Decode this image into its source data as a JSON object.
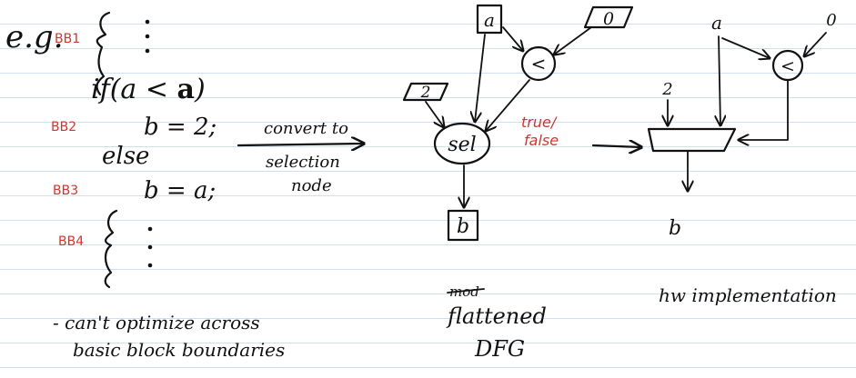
{
  "left_code": {
    "eg_label": "e.g.",
    "bb1_label": "BB1",
    "if_stmt_prefix": "if(a < ",
    "if_stmt_bold": "a",
    "if_stmt_suffix": ")",
    "bb2_label": "BB2",
    "stmt_b_eq_2": "b = 2;",
    "else_label": "else",
    "bb3_label": "BB3",
    "stmt_b_eq_a": "b = a;",
    "bb4_label": "BB4",
    "note_line1": "- can't optimize across",
    "note_line2": "basic block boundaries"
  },
  "convert_label": {
    "line1": "convert to",
    "line2": "selection",
    "line3": "node"
  },
  "dfg": {
    "node_a": "a",
    "node_zero": "0",
    "node_lt": "<",
    "node_two": "2",
    "node_sel": "sel",
    "node_b": "b",
    "true_label": "true/",
    "false_label": "false",
    "caption_struck": "mod",
    "caption_line1": "flattened",
    "caption_line2": "DFG"
  },
  "hw": {
    "input_a": "a",
    "input_zero": "0",
    "comparator": "<",
    "input_two": "2",
    "output_b": "b",
    "caption": "hw implementation"
  }
}
